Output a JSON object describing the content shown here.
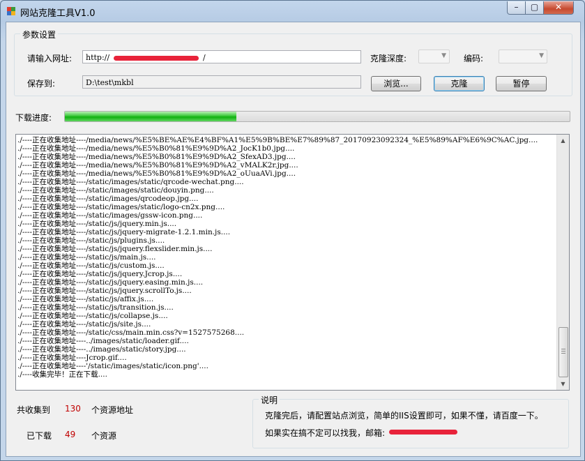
{
  "window": {
    "title": "网站克隆工具V1.0",
    "controls": {
      "minimize": "–",
      "maximize": "▢",
      "close": "✕"
    }
  },
  "params": {
    "group_title": "参数设置",
    "url_label": "请输入网址:",
    "url_value": "http://",
    "url_suffix": "/",
    "save_label": "保存到:",
    "save_value": "D:\\test\\mkbl",
    "depth_label": "克隆深度:",
    "encoding_label": "编码:",
    "browse_button": "浏览...",
    "clone_button": "克隆",
    "pause_button": "暂停"
  },
  "progress": {
    "label": "下载进度:",
    "fraction": 0.34
  },
  "log": {
    "lines": [
      "./----正在收集地址----/media/news/%E5%BE%AE%E4%BF%A1%E5%9B%BE%E7%89%87_20170923092324_%E5%89%AF%E6%9C%AC.jpg....",
      "./----正在收集地址----/media/news/%E5%B0%81%E9%9D%A2_JocK1b0.jpg....",
      "./----正在收集地址----/media/news/%E5%B0%81%E9%9D%A2_SfexAD3.jpg....",
      "./----正在收集地址----/media/news/%E5%B0%81%E9%9D%A2_vMALK2r.jpg....",
      "./----正在收集地址----/media/news/%E5%B0%81%E9%9D%A2_oUuaAVi.jpg....",
      "./----正在收集地址----/static/images/static/qrcode-wechat.png....",
      "./----正在收集地址----/static/images/static/douyin.png....",
      "./----正在收集地址----/static/images/qrcodeop.jpg....",
      "./----正在收集地址----/static/images/static/logo-cn2x.png....",
      "./----正在收集地址----/static/images/gssw-icon.png....",
      "./----正在收集地址----/static/js/jquery.min.js....",
      "./----正在收集地址----/static/js/jquery-migrate-1.2.1.min.js....",
      "./----正在收集地址----/static/js/plugins.js....",
      "./----正在收集地址----/static/js/jquery.flexslider.min.js....",
      "./----正在收集地址----/static/js/main.js....",
      "./----正在收集地址----/static/js/custom.js....",
      "./----正在收集地址----/static/js/jquery.Jcrop.js....",
      "./----正在收集地址----/static/js/jquery.easing.min.js....",
      "./----正在收集地址----/static/js/jquery.scrollTo.js....",
      "./----正在收集地址----/static/js/affix.js....",
      "./----正在收集地址----/static/js/transition.js....",
      "./----正在收集地址----/static/js/collapse.js....",
      "./----正在收集地址----/static/js/site.js....",
      "./----正在收集地址----/static/css/main.min.css?v=1527575268....",
      "./----正在收集地址----../images/static/loader.gif....",
      "./----正在收集地址----../images/static/story.jpg....",
      "./----正在收集地址----Jcrop.gif....",
      "./----正在收集地址----'/static/images/static/icon.png'....",
      "./----收集完毕！正在下载...."
    ]
  },
  "stats": {
    "collected_label": "共收集到",
    "collected_count": "130",
    "collected_suffix": "个资源地址",
    "downloaded_label": "已下载",
    "downloaded_count": "49",
    "downloaded_suffix": "个资源"
  },
  "notes": {
    "title": "说明",
    "line1": "克隆完后，请配置站点浏览，简单的IIS设置即可，如果不懂，请百度一下。",
    "line2": "如果实在搞不定可以找我，邮箱:"
  },
  "colors": {
    "accent_red": "#c00000",
    "progress_green": "#10b010",
    "redaction": "#e8233a"
  }
}
